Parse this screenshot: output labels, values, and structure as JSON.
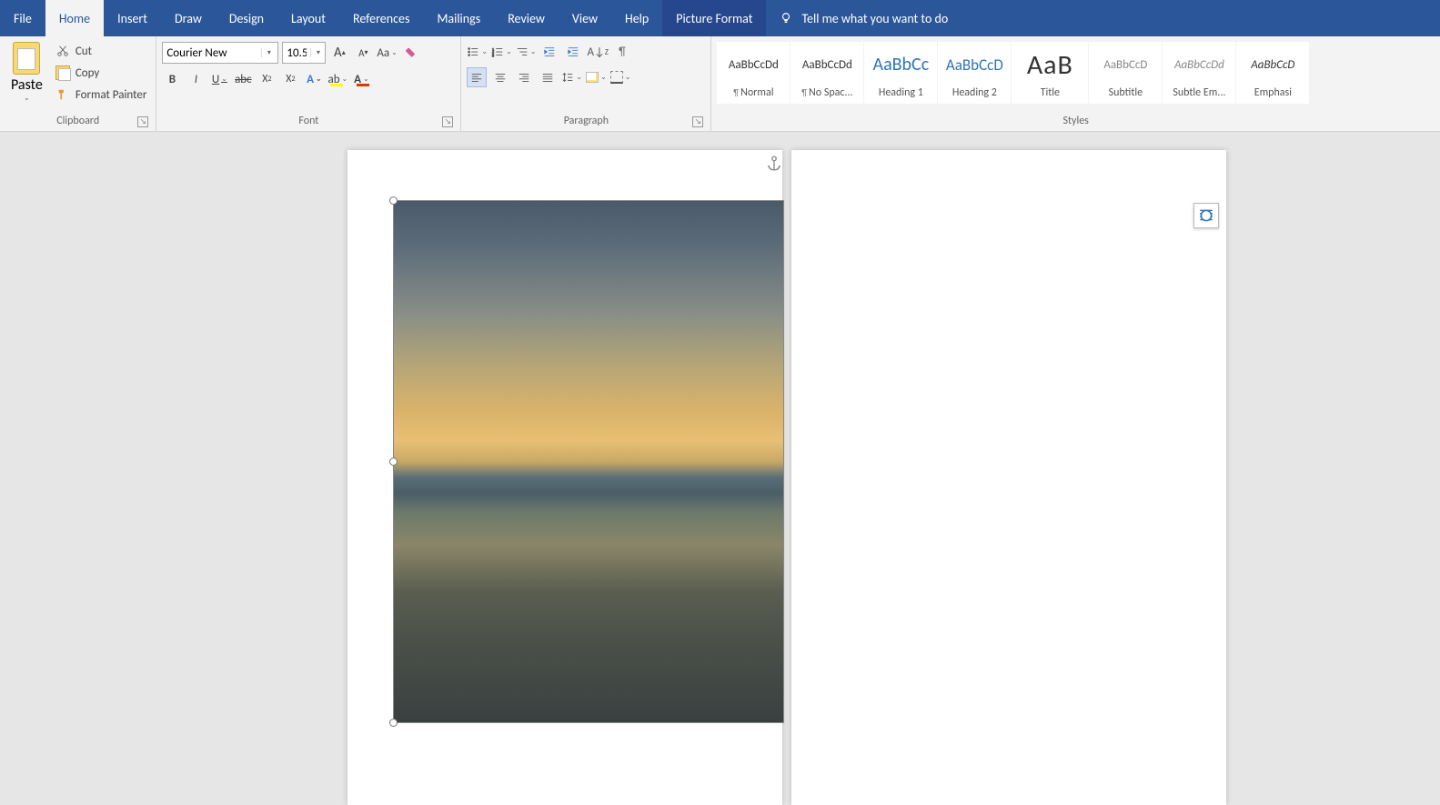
{
  "menu": {
    "file": "File",
    "home": "Home",
    "insert": "Insert",
    "draw": "Draw",
    "design": "Design",
    "layout": "Layout",
    "references": "References",
    "mailings": "Mailings",
    "review": "Review",
    "view": "View",
    "help": "Help",
    "picture_format": "Picture Format",
    "tell_me": "Tell me what you want to do"
  },
  "clipboard": {
    "paste": "Paste",
    "cut": "Cut",
    "copy": "Copy",
    "format_painter": "Format Painter",
    "label": "Clipboard"
  },
  "font": {
    "name": "Courier New",
    "size": "10.5",
    "label": "Font"
  },
  "paragraph": {
    "label": "Paragraph"
  },
  "styles": {
    "label": "Styles",
    "sample": "AaBbCcDd",
    "sample_short": "AaBbCc",
    "sample_shortD": "AaBbCcD",
    "sample_title": "AaB",
    "items": [
      {
        "name": "¶ Normal"
      },
      {
        "name": "¶ No Spac..."
      },
      {
        "name": "Heading 1"
      },
      {
        "name": "Heading 2"
      },
      {
        "name": "Title"
      },
      {
        "name": "Subtitle"
      },
      {
        "name": "Subtle Em..."
      },
      {
        "name": "Emphasi"
      }
    ]
  }
}
